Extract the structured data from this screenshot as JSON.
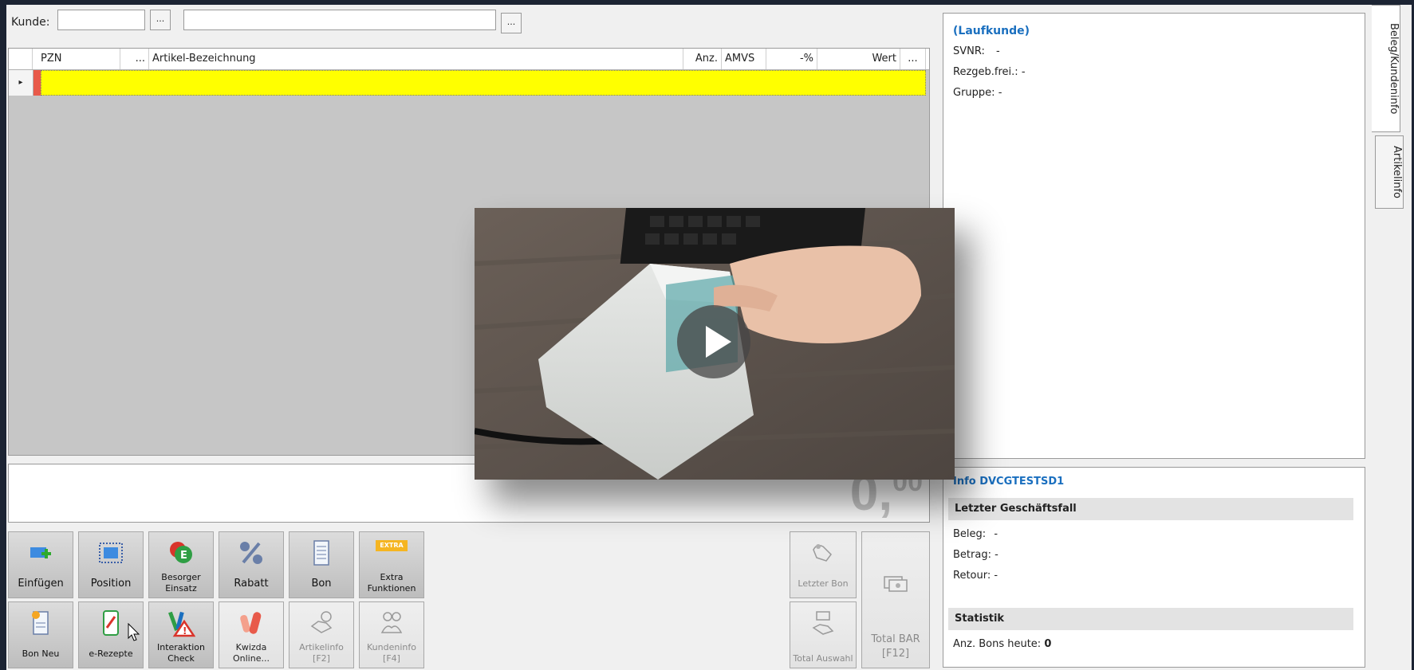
{
  "header": {
    "kunde_label": "Kunde:",
    "kunde_value": "",
    "kunde_name": "",
    "dots": "..."
  },
  "grid": {
    "columns": [
      "PZN",
      "...",
      "Artikel-Bezeichnung",
      "Anz.",
      "AMVS",
      "-%",
      "Wert",
      "..."
    ],
    "row_marker": "▸"
  },
  "total": {
    "value": "0,",
    "decimals": "00"
  },
  "toolbar": {
    "row1": [
      {
        "label": "Einfügen",
        "icon": "insert-icon"
      },
      {
        "label": "Position",
        "icon": "position-icon"
      },
      {
        "label": "Besorger Einsatz",
        "icon": "besorger-icon"
      },
      {
        "label": "Rabatt",
        "icon": "percent-icon"
      },
      {
        "label": "Bon",
        "icon": "receipt-icon"
      },
      {
        "label": "Extra Funktionen",
        "icon": "extra-icon",
        "badge": "EXTRA"
      }
    ],
    "row2": [
      {
        "label": "Bon Neu",
        "icon": "new-receipt-icon"
      },
      {
        "label": "e-Rezepte",
        "icon": "e-prescription-icon"
      },
      {
        "label": "Interaktion Check",
        "icon": "interaction-icon"
      },
      {
        "label": "Kwizda Online...",
        "icon": "kwizda-icon"
      },
      {
        "label": "Artikelinfo [F2]",
        "icon": "article-info-icon"
      },
      {
        "label": "Kundeninfo [F4]",
        "icon": "customer-info-icon"
      }
    ],
    "right": {
      "letzter_bon": "Letzter Bon",
      "total_auswahl": "Total Auswahl",
      "total_bar": "Total BAR [F12]"
    }
  },
  "customer_panel": {
    "name": "(Laufkunde)",
    "svnr_label": "SVNR:",
    "svnr_value": "-",
    "rezgeb_label": "Rezgeb.frei.:",
    "rezgeb_value": "-",
    "gruppe_label": "Gruppe:",
    "gruppe_value": "-"
  },
  "info_panel": {
    "title": "Info DVCGTESTSD1",
    "section1": "Letzter Geschäftsfall",
    "beleg_label": "Beleg:",
    "beleg_value": "-",
    "betrag_label": "Betrag:",
    "betrag_value": "-",
    "retour_label": "Retour:",
    "retour_value": "-",
    "section2": "Statistik",
    "bons_label": "Anz. Bons heute:",
    "bons_value": "0"
  },
  "side_tabs": [
    "Beleg/Kundeninfo",
    "Artikelinfo"
  ],
  "colors": {
    "accent_blue": "#1a6fbf",
    "row_yellow": "#ffff00",
    "row_red": "#e85a4a"
  }
}
